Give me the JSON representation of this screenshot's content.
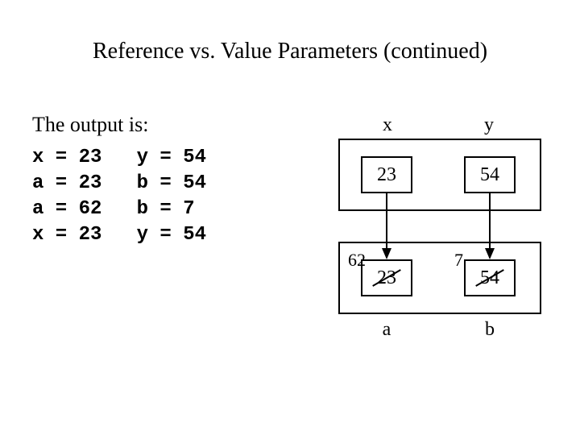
{
  "title": "Reference vs. Value Parameters (continued)",
  "lead": "The output is:",
  "output_lines": {
    "l1": "x = 23   y = 54",
    "l2": "a = 23   b = 54",
    "l3": "a = 62   b = 7",
    "l4": "x = 23   y = 54"
  },
  "labels": {
    "x": "x",
    "y": "y",
    "a": "a",
    "b": "b"
  },
  "boxes": {
    "x_val": "23",
    "y_val": "54",
    "a_old": "23",
    "b_old": "54",
    "a_new": "62",
    "b_new": "7"
  }
}
